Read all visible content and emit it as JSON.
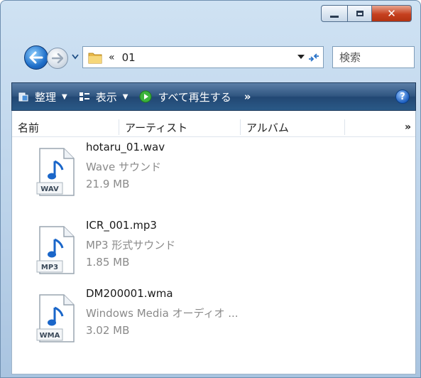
{
  "window": {
    "caption": {
      "close_glyph": "✕"
    }
  },
  "nav": {
    "address_chevron": "«",
    "address_path": "01",
    "search_placeholder": "検索"
  },
  "commands": [
    {
      "label": "整理",
      "icon": "organize-icon"
    },
    {
      "label": "表示",
      "icon": "views-icon"
    },
    {
      "label": "すべて再生する",
      "icon": "play-all-icon"
    }
  ],
  "command_more": "»",
  "help_glyph": "?",
  "columns": [
    "名前",
    "アーティスト",
    "アルバム"
  ],
  "columns_more": "»",
  "files": [
    {
      "name": "hotaru_01.wav",
      "type": "Wave サウンド",
      "size": "21.9 MB",
      "badge": "WAV"
    },
    {
      "name": "ICR_001.mp3",
      "type": "MP3 形式サウンド",
      "size": "1.85 MB",
      "badge": "MP3"
    },
    {
      "name": "DM200001.wma",
      "type": "Windows Media オーディオ ...",
      "size": "3.02 MB",
      "badge": "WMA"
    }
  ],
  "colors": {
    "accent": "#1f6fc9",
    "command_bar": "#2f5580",
    "close_button": "#c6401f"
  }
}
